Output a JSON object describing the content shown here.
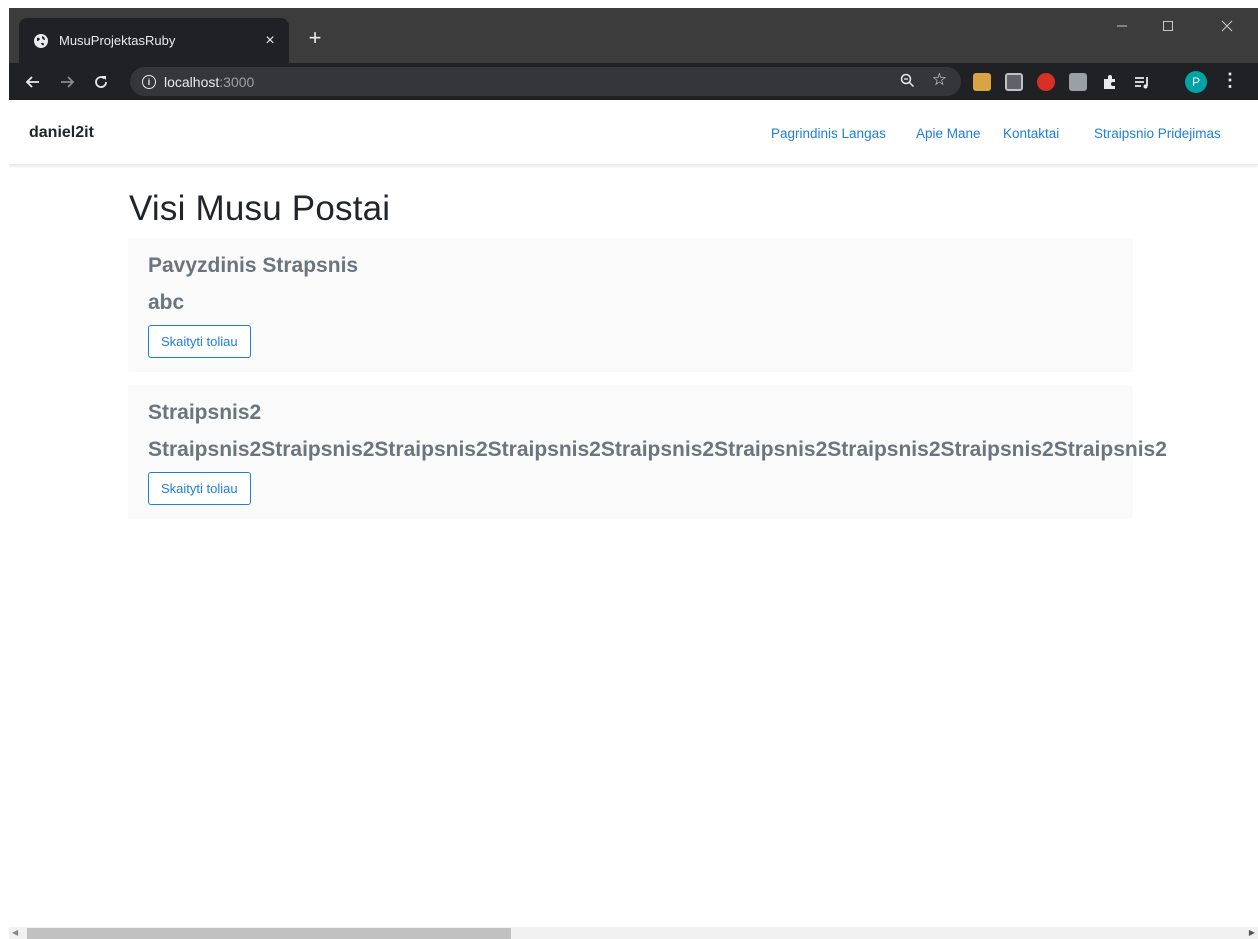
{
  "browser": {
    "tab_title": "MusuProjektasRuby",
    "tab_close": "×",
    "new_tab": "+",
    "url_host": "localhost",
    "url_port": ":3000",
    "profile_initial": "P"
  },
  "site": {
    "brand": "daniel2it",
    "nav": [
      "Pagrindinis Langas",
      "Apie Mane",
      "Kontaktai",
      "Straipsnio Pridejimas"
    ]
  },
  "page": {
    "title": "Visi Musu Postai",
    "posts": [
      {
        "title": "Pavyzdinis Strapsnis",
        "body": "abc",
        "button": "Skaityti toliau"
      },
      {
        "title": "Straipsnis2",
        "body": "Straipsnis2Straipsnis2Straipsnis2Straipsnis2Straipsnis2Straipsnis2Straipsnis2Straipsnis2Straipsnis2",
        "button": "Skaityti toliau"
      }
    ]
  },
  "colors": {
    "link": "#1f7ed9",
    "muted_text": "#6c757d",
    "chrome_dark": "#202124",
    "titlebar": "#3c3c3c",
    "profile": "#00a4a6"
  }
}
